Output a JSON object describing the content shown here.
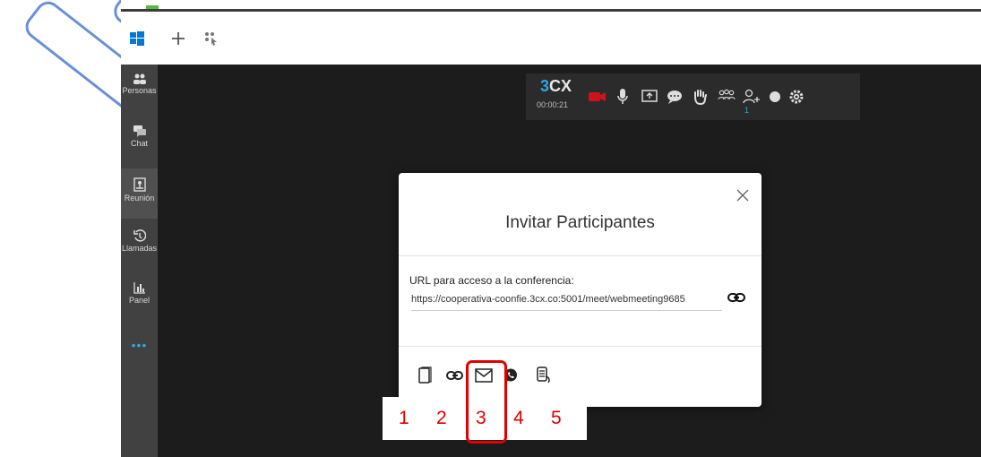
{
  "toolbar": {
    "windows_icon": "windows-logo-icon",
    "add_icon": "plus-icon",
    "people_icon": "group-pointer-icon"
  },
  "sidebar": {
    "items": [
      {
        "label": "Personas",
        "icon": "people-icon"
      },
      {
        "label": "Chat",
        "icon": "chat-icon"
      },
      {
        "label": "Reunión",
        "icon": "meeting-icon"
      },
      {
        "label": "Llamadas",
        "icon": "history-icon"
      },
      {
        "label": "Panel",
        "icon": "chart-icon"
      }
    ],
    "more": "•••"
  },
  "callbar": {
    "brand_prefix": "3",
    "brand_suffix": "CX",
    "timer": "00:00:21",
    "participant_count": "1"
  },
  "modal": {
    "title": "Invitar Participantes",
    "url_label": "URL para acceso a la conferencia:",
    "url_value": "https://cooperativa-coonfie.3cx.co:5001/meet/webmeeting9685",
    "share_buttons": [
      "copy-icon",
      "link-icon",
      "email-icon",
      "whatsapp-icon",
      "phone-icon"
    ]
  },
  "annotations": [
    "1",
    "2",
    "3",
    "4",
    "5"
  ],
  "colors": {
    "accent": "#2aa7e0",
    "highlight": "#e00000",
    "stage": "#1c1c1c",
    "sidebar": "#414141"
  }
}
